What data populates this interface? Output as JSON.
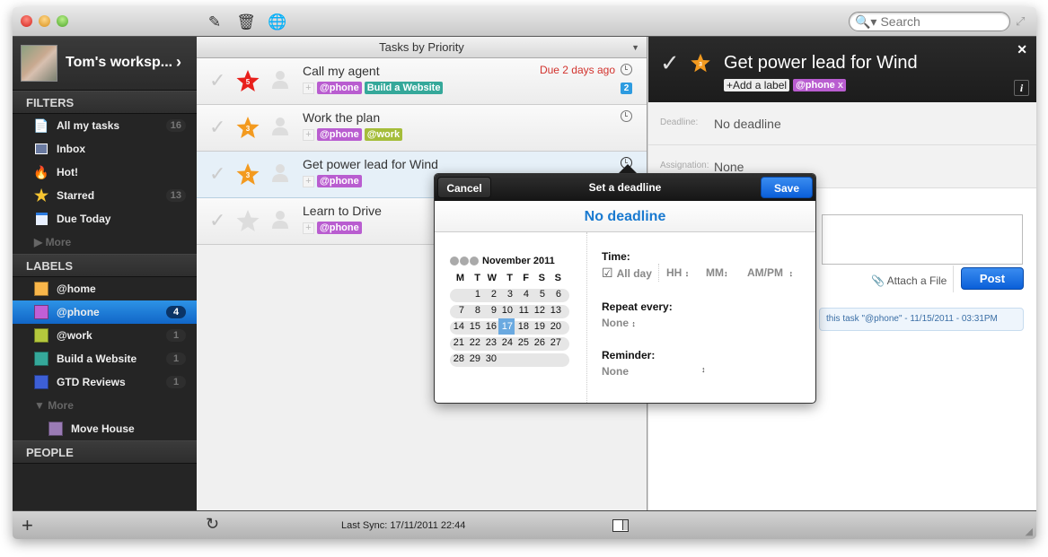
{
  "window": {
    "toolbar_icons": [
      "compose-icon",
      "trash-icon",
      "globe-icon"
    ],
    "search": {
      "placeholder": "Search",
      "value": ""
    }
  },
  "sidebar": {
    "workspace": "Tom's worksp...",
    "filters_title": "FILTERS",
    "filters": [
      {
        "label": "All my tasks",
        "icon": "all-tasks-icon",
        "count": "16"
      },
      {
        "label": "Inbox",
        "icon": "inbox-icon",
        "count": ""
      },
      {
        "label": "Hot!",
        "icon": "fire-icon",
        "count": ""
      },
      {
        "label": "Starred",
        "icon": "star-icon",
        "count": "13"
      },
      {
        "label": "Due Today",
        "icon": "calendar-icon",
        "count": ""
      }
    ],
    "filters_more": "More",
    "labels_title": "LABELS",
    "labels": [
      {
        "label": "@home",
        "color": "#f9b64a",
        "count": ""
      },
      {
        "label": "@phone",
        "color": "#c05fd6",
        "count": "4",
        "selected": true
      },
      {
        "label": "@work",
        "color": "#b5c83d",
        "count": "1"
      },
      {
        "label": "Build a Website",
        "color": "#35a89a",
        "count": "1"
      },
      {
        "label": "GTD Reviews",
        "color": "#3d5fd6",
        "count": "1"
      }
    ],
    "labels_more": "More",
    "labels_more_items": [
      {
        "label": "Move House",
        "color": "#9a7bb5"
      }
    ],
    "people_title": "PEOPLE"
  },
  "tasks": {
    "header": "Tasks by Priority",
    "items": [
      {
        "title": "Call my agent",
        "priority": "5",
        "star_color": "#e8201c",
        "tags": [
          {
            "label": "@phone",
            "color": "#b95dd0"
          },
          {
            "label": "Build a Website",
            "color": "#35a89a"
          }
        ],
        "due": "Due 2 days ago",
        "comments": "2"
      },
      {
        "title": "Work the plan",
        "priority": "3",
        "star_color": "#f39a1f",
        "tags": [
          {
            "label": "@phone",
            "color": "#b95dd0"
          },
          {
            "label": "@work",
            "color": "#a5bd3a"
          }
        ],
        "due": "",
        "comments": ""
      },
      {
        "title": "Get power lead for Wind",
        "priority": "3",
        "star_color": "#f39a1f",
        "tags": [
          {
            "label": "@phone",
            "color": "#b95dd0"
          }
        ],
        "due": "",
        "comments": "",
        "selected": true
      },
      {
        "title": "Learn to Drive",
        "priority": "",
        "star_color": "#dddddd",
        "tags": [
          {
            "label": "@phone",
            "color": "#b95dd0"
          }
        ],
        "due": "",
        "comments": ""
      }
    ]
  },
  "detail": {
    "title": "Get power lead for Wind",
    "priority": "3",
    "add_label": "+Add a label",
    "label": "@phone",
    "label_remove": "x",
    "deadline_label": "Deadline:",
    "deadline_value": "No deadline",
    "assign_label": "Assignation:",
    "assign_value": "None",
    "attach": "Attach a File",
    "post": "Post",
    "activity": "this task \"@phone\" - 11/15/2011 - 03:31PM"
  },
  "popup": {
    "cancel": "Cancel",
    "title": "Set a deadline",
    "save": "Save",
    "status": "No deadline",
    "month": "November 2011",
    "weekdays": [
      "M",
      "T",
      "W",
      "T",
      "F",
      "S",
      "S"
    ],
    "weeks": [
      [
        "",
        "1",
        "2",
        "3",
        "4",
        "5",
        "6"
      ],
      [
        "7",
        "8",
        "9",
        "10",
        "11",
        "12",
        "13"
      ],
      [
        "14",
        "15",
        "16",
        "17",
        "18",
        "19",
        "20"
      ],
      [
        "21",
        "22",
        "23",
        "24",
        "25",
        "26",
        "27"
      ],
      [
        "28",
        "29",
        "30",
        "",
        "",
        "",
        ""
      ]
    ],
    "today": "17",
    "time_label": "Time:",
    "all_day": "All day",
    "all_day_checked": true,
    "hh": "HH",
    "mm": "MM",
    "ampm": "AM/PM",
    "repeat_label": "Repeat every:",
    "repeat_value": "None",
    "reminder_label": "Reminder:",
    "reminder_value": "None"
  },
  "footer": {
    "last_sync": "Last Sync: 17/11/2011 22:44"
  }
}
